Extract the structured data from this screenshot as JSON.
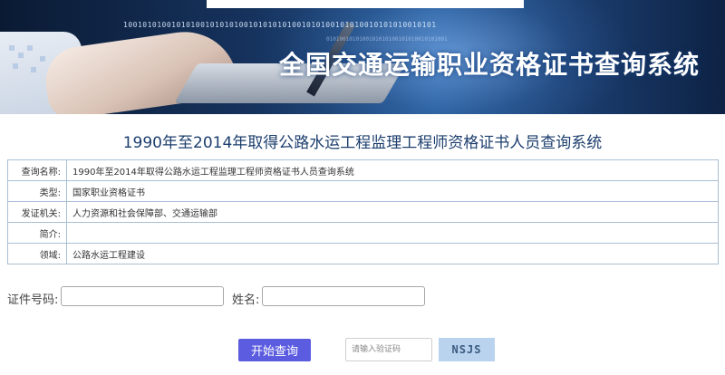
{
  "banner": {
    "system_title": "全国交通运输职业资格证书查询系统",
    "binary_text": "10010101001010100101010100101010101001010100101010010101010010101",
    "binary_text_small": "0101001010100101010100101010010101001"
  },
  "page_title": "1990年至2014年取得公路水运工程监理工程师资格证书人员查询系统",
  "info_table": [
    {
      "key": "查询名称:",
      "value": "1990年至2014年取得公路水运工程监理工程师资格证书人员查询系统"
    },
    {
      "key": "类型:",
      "value": "国家职业资格证书"
    },
    {
      "key": "发证机关:",
      "value": "人力资源和社会保障部、交通运输部"
    },
    {
      "key": "简介:",
      "value": ""
    },
    {
      "key": "领域:",
      "value": "公路水运工程建设"
    }
  ],
  "form": {
    "cert_no_label": "证件号码:",
    "cert_no_value": "",
    "name_label": "姓名:",
    "name_value": "",
    "query_button": "开始查询",
    "captcha_placeholder": "请输入验证码",
    "captcha_code": "NSJS"
  },
  "colors": {
    "query_button": "#5b5ce0",
    "title_text": "#1c3e6e",
    "table_border": "#a9bfd6",
    "captcha_bg": "#b9d3ee"
  }
}
